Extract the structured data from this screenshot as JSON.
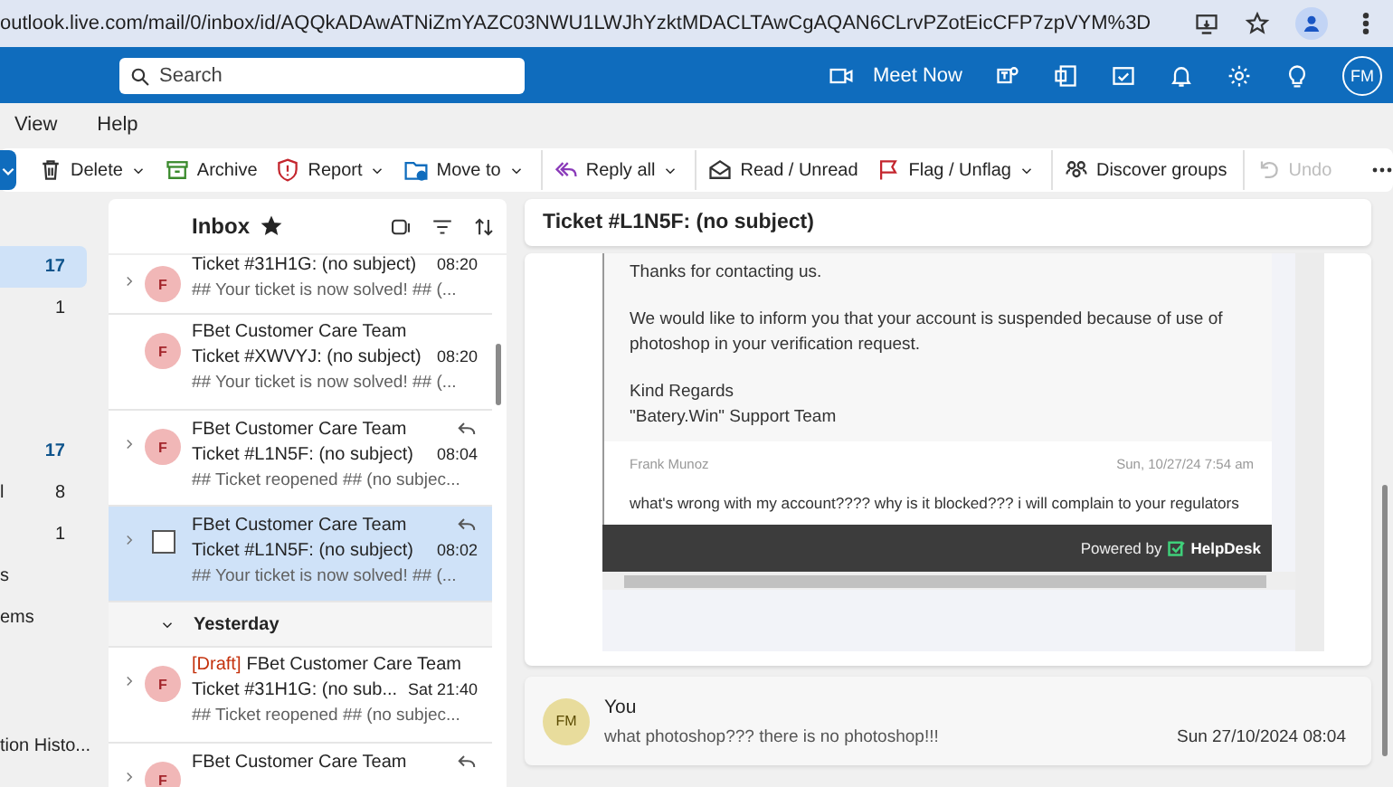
{
  "browser": {
    "url": "outlook.live.com/mail/0/inbox/id/AQQkADAwATNiZmYAZC03NWU1LWJhYzktMDACLTAwCgAQAN6CLrvPZotEicCFP7zpVYM%3D"
  },
  "header": {
    "search": {
      "placeholder": "Search"
    },
    "meet_now": "Meet Now",
    "avatar": "FM"
  },
  "menu": [
    "View",
    "Help"
  ],
  "toolbar": [
    {
      "label": "Delete",
      "has_menu": true,
      "disabled": false,
      "separator_before": false
    },
    {
      "label": "Archive",
      "has_menu": false,
      "disabled": false,
      "separator_before": false
    },
    {
      "label": "Report",
      "has_menu": true,
      "disabled": false,
      "separator_before": false
    },
    {
      "label": "Move to",
      "has_menu": true,
      "disabled": false,
      "separator_before": false
    },
    {
      "label": "Reply all",
      "has_menu": true,
      "disabled": false,
      "separator_before": true
    },
    {
      "label": "Read / Unread",
      "has_menu": false,
      "disabled": false,
      "separator_before": true
    },
    {
      "label": "Flag / Unflag",
      "has_menu": true,
      "disabled": false,
      "separator_before": false
    },
    {
      "label": "Discover groups",
      "has_menu": false,
      "disabled": false,
      "separator_before": true
    },
    {
      "label": "Undo",
      "has_menu": false,
      "disabled": true,
      "separator_before": true
    }
  ],
  "sidebar": {
    "sections": [
      {
        "items": [
          {
            "count": "17",
            "unread": true,
            "selected": true
          },
          {
            "count": "1",
            "unread": false,
            "selected": false
          }
        ]
      },
      {
        "items": [
          {
            "count": "17",
            "unread": true,
            "selected": false
          },
          {
            "label": "l",
            "count": "8",
            "unread": false,
            "selected": false
          },
          {
            "count": "1",
            "unread": false,
            "selected": false
          },
          {
            "label": "s",
            "selected": false
          },
          {
            "label": "ems",
            "selected": false
          }
        ]
      },
      {
        "items": [
          {
            "label": "tion Histo...",
            "selected": false
          }
        ]
      }
    ]
  },
  "message_list": {
    "title": "Inbox",
    "groups": [
      {
        "messages": [
          {
            "subject": "Ticket #31H1G: (no subject)",
            "time": "08:20",
            "preview": "## Your ticket is now solved! ## (...",
            "avatar": "F",
            "has_thread": true,
            "selected": false
          },
          {
            "sender": "FBet Customer Care Team",
            "subject": "Ticket #XWVYJ: (no subject)",
            "time": "08:20",
            "preview": "## Your ticket is now solved! ## (...",
            "avatar": "F",
            "has_thread": false,
            "replied": false,
            "selected": false
          },
          {
            "sender": "FBet Customer Care Team",
            "subject": "Ticket #L1N5F: (no subject)",
            "time": "08:04",
            "preview": "## Ticket reopened ## (no subjec...",
            "avatar": "F",
            "has_thread": true,
            "replied": true,
            "selected": false
          },
          {
            "sender": "FBet Customer Care Team",
            "subject": "Ticket #L1N5F: (no subject)",
            "time": "08:02",
            "preview": "## Your ticket is now solved! ## (...",
            "has_thread": true,
            "replied": true,
            "selected": true
          }
        ]
      },
      {
        "label": "Yesterday",
        "messages": [
          {
            "draft_label": "[Draft]",
            "sender": "FBet Customer Care Team",
            "subject": "Ticket #31H1G: (no sub...",
            "time": "Sat 21:40",
            "preview": "## Ticket reopened ## (no subjec...",
            "avatar": "F",
            "has_thread": true,
            "replied": false,
            "selected": false
          },
          {
            "sender": "FBet Customer Care Team",
            "avatar": "F",
            "has_thread": true,
            "replied": true,
            "selected": false
          }
        ]
      }
    ]
  },
  "reading_pane": {
    "subject": "Ticket #L1N5F: (no subject)",
    "email_body": [
      "Thanks for contacting us.",
      "We would like to inform you that your account is suspended because of use of photoshop in your verification request.",
      "Kind Regards\n\"Batery.Win\" Support Team"
    ],
    "comment": {
      "author": "Frank Munoz",
      "date": "Sun, 10/27/24 7:54 am",
      "text": "what's wrong with my account???? why is it blocked??? i will complain to your regulators"
    },
    "footer": {
      "powered_by": "Powered by",
      "brand": "HelpDesk"
    },
    "reply": {
      "avatar": "FM",
      "sender": "You",
      "text": "what photoshop??? there is no photoshop!!!",
      "date": "Sun 27/10/2024 08:04"
    }
  }
}
